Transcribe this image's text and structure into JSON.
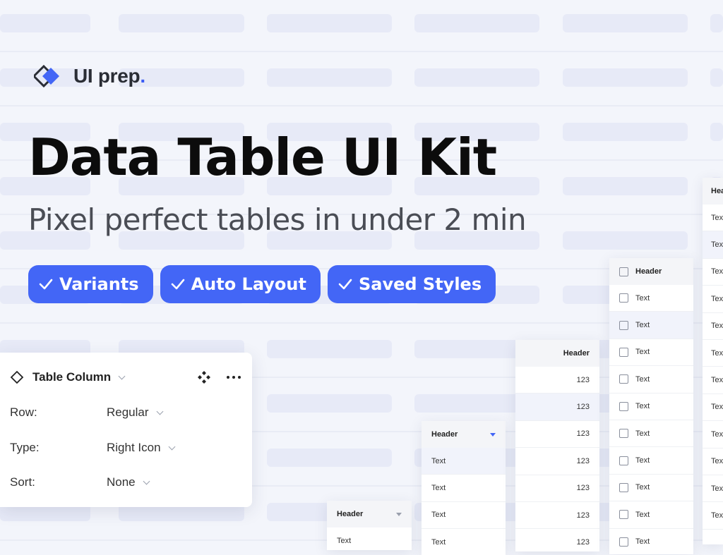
{
  "brand": {
    "name": "UI prep",
    "dot": ".",
    "accent": "#3b5cf5"
  },
  "headline": "Data Table UI Kit",
  "subheadline": "Pixel perfect tables in under 2 min",
  "features": [
    "Variants",
    "Auto Layout",
    "Saved Styles"
  ],
  "panel": {
    "title": "Table Column",
    "rows": [
      {
        "label": "Row:",
        "value": "Regular"
      },
      {
        "label": "Type:",
        "value": "Right Icon"
      },
      {
        "label": "Sort:",
        "value": "None"
      }
    ]
  },
  "tables": {
    "card1": {
      "header": "Header",
      "cells": [
        "Text"
      ]
    },
    "card2": {
      "header": "Header",
      "cells": [
        "Text",
        "Text",
        "Text",
        "Text"
      ]
    },
    "card3": {
      "header": "Header",
      "cells": [
        "123",
        "123",
        "123",
        "123",
        "123",
        "123",
        "123"
      ]
    },
    "card4": {
      "header": "Header",
      "cells": [
        "Text",
        "Text",
        "Text",
        "Text",
        "Text",
        "Text",
        "Text",
        "Text",
        "Text",
        "Text"
      ]
    },
    "card5": {
      "header": "Hea",
      "cells": [
        "Text",
        "Text",
        "Text",
        "Text",
        "Text",
        "Text",
        "Text",
        "Text",
        "Text",
        "Text",
        "Text",
        "Text"
      ]
    }
  },
  "colors": {
    "accent": "#4366f6",
    "background": "#f3f5fb"
  }
}
